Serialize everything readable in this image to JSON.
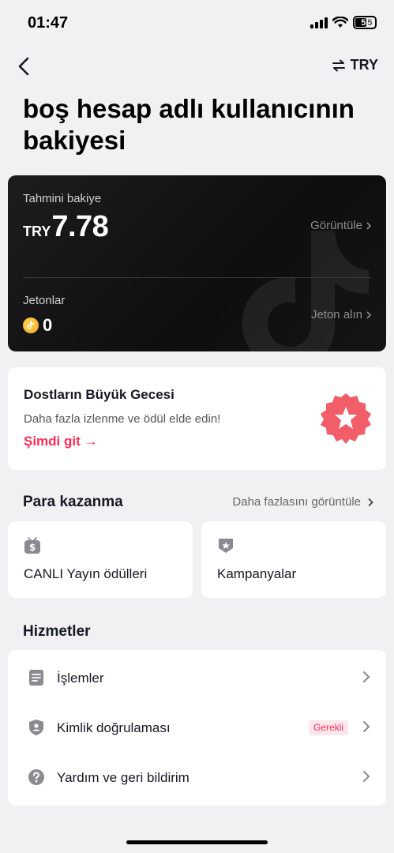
{
  "status_bar": {
    "time": "01:47",
    "battery": "55",
    "battery_fill": "5",
    "battery_rest": "5"
  },
  "nav": {
    "currency": "TRY"
  },
  "page": {
    "title": "boş hesap adlı kullanıcının bakiyesi"
  },
  "balance": {
    "estimated_label": "Tahmini bakiye",
    "currency_prefix": "TRY",
    "amount": "7.78",
    "view_label": "Görüntüle",
    "coins_label": "Jetonlar",
    "coins_value": "0",
    "get_coins_label": "Jeton alın"
  },
  "promo": {
    "title": "Dostların Büyük Gecesi",
    "subtitle": "Daha fazla izlenme ve ödül elde edin!",
    "cta": "Şimdi git →"
  },
  "earning": {
    "title": "Para kazanma",
    "more": "Daha fazlasını görüntüle",
    "items": [
      {
        "label": "CANLI Yayın ödülleri",
        "icon": "money-tv-icon"
      },
      {
        "label": "Kampanyalar",
        "icon": "campaign-badge-icon"
      }
    ]
  },
  "services": {
    "title": "Hizmetler",
    "items": [
      {
        "label": "İşlemler",
        "icon": "document-icon"
      },
      {
        "label": "Kimlik doğrulaması",
        "icon": "shield-user-icon",
        "badge": "Gerekli"
      },
      {
        "label": "Yardım ve geri bildirim",
        "icon": "help-icon"
      }
    ]
  },
  "colors": {
    "accent": "#fe2c55",
    "card_dark": "#151516",
    "icon_gray": "#8a8b91",
    "coin": "#f5a623"
  }
}
